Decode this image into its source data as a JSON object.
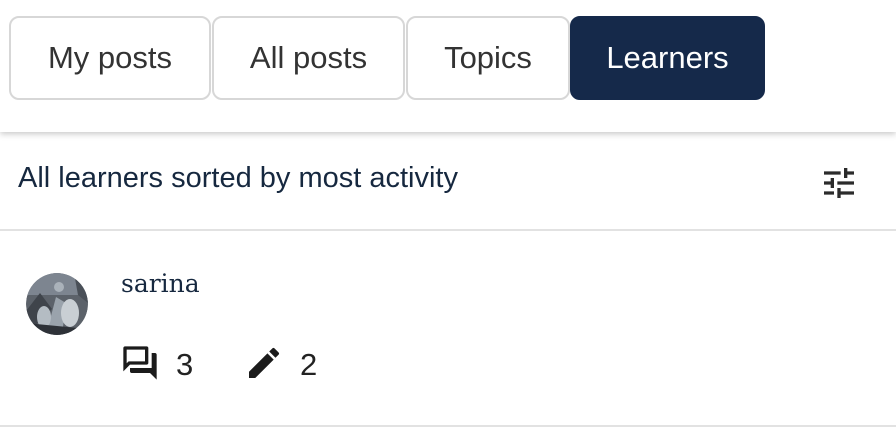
{
  "tabs": [
    {
      "label": "My posts",
      "active": false
    },
    {
      "label": "All posts",
      "active": false
    },
    {
      "label": "Topics",
      "active": false
    },
    {
      "label": "Learners",
      "active": true
    }
  ],
  "header": {
    "title": "All learners sorted by most activity",
    "filter_icon": "sliders-filter-icon"
  },
  "learners": [
    {
      "username": "sarina",
      "avatar": "user-photo",
      "threads_icon": "forum-icon",
      "threads_count": "3",
      "responses_icon": "pencil-icon",
      "responses_count": "2"
    }
  ],
  "colors": {
    "active_tab_bg": "#15294a",
    "text_primary": "#16283f",
    "border": "#d7d7d7"
  }
}
